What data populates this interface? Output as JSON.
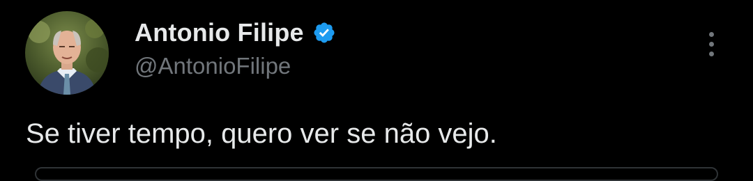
{
  "tweet": {
    "author": {
      "display_name": "Antonio Filipe",
      "handle": "@AntonioFilipe",
      "verified": true,
      "verified_badge_icon": "verified-badge-icon",
      "avatar_icon": "profile-avatar"
    },
    "text": "Se tiver tempo, quero ver se não vejo.",
    "more_menu_icon": "more-options-vertical-icon"
  },
  "colors": {
    "background": "#000000",
    "primary_text": "#e7e9ea",
    "secondary_text": "#71767b",
    "verified_blue": "#1d9bf0",
    "border": "#2f3336"
  }
}
